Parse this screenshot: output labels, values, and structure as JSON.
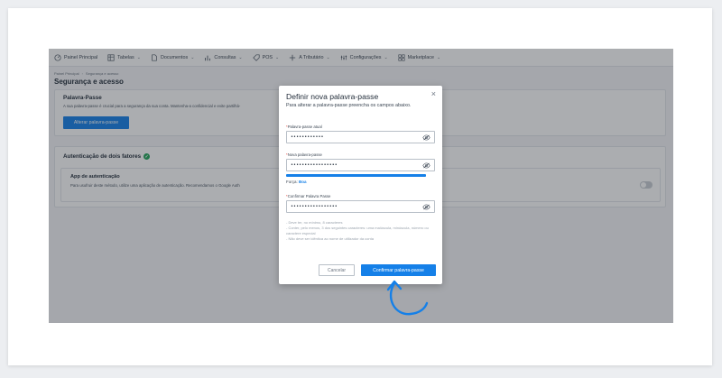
{
  "nav": {
    "items": [
      {
        "label": "Painel Principal",
        "icon": "dashboard-icon",
        "chevron": false
      },
      {
        "label": "Tabelas",
        "icon": "table-icon",
        "chevron": true
      },
      {
        "label": "Documentos",
        "icon": "document-icon",
        "chevron": true
      },
      {
        "label": "Consultas",
        "icon": "chart-icon",
        "chevron": true
      },
      {
        "label": "POS",
        "icon": "tag-icon",
        "chevron": true
      },
      {
        "label": "A Tributário",
        "icon": "plus-icon",
        "chevron": true
      },
      {
        "label": "Configurações",
        "icon": "settings-icon",
        "chevron": true
      },
      {
        "label": "Marketplace",
        "icon": "grid-icon",
        "chevron": true
      }
    ]
  },
  "breadcrumb": {
    "home": "Painel Principal",
    "sep": "›",
    "current": "Segurança e acesso"
  },
  "page": {
    "title": "Segurança e acesso"
  },
  "password_section": {
    "title": "Palavra-Passe",
    "description": "A sua palavra-passe é crucial para a segurança da sua conta. Mantenha-a confidencial e evite partilhá-",
    "button": "Alterar palavra-passe"
  },
  "twofa_section": {
    "title": "Autenticação de dois fatores",
    "app_title": "App de autenticação",
    "app_description": "Para usufruir deste método, utilize uma aplicação de autenticação. Recomendamos o Google Auth",
    "toggle_on": false
  },
  "modal": {
    "title": "Definir nova palavra-passe",
    "description": "Para alterar a palavra-passe preencha os campos abaixo.",
    "current_label": "Palavra-passe atual",
    "current_value": "••••••••••••",
    "new_label": "Nova palavra-passe",
    "new_value": "•••••••••••••••••",
    "strength_label": "Força:",
    "strength_value": "Boa",
    "strength_fraction": 0.94,
    "confirm_label": "Confirmar Palavra Passe",
    "confirm_value": "•••••••••••••••••",
    "rules": [
      "- Deve ter, no mínimo, 8 caracteres",
      "- Conter, pelo menos, 3 dos seguintes caracteres: uma maiúscula, minúscula, número ou caractere especial",
      "- Não deve ser idêntica ao nome de utilizador da conta"
    ],
    "cancel": "Cancelar",
    "confirm": "Confirmar palavra-passe"
  },
  "colors": {
    "primary": "#1580e8",
    "success": "#22a55a",
    "required": "#e0453a"
  }
}
